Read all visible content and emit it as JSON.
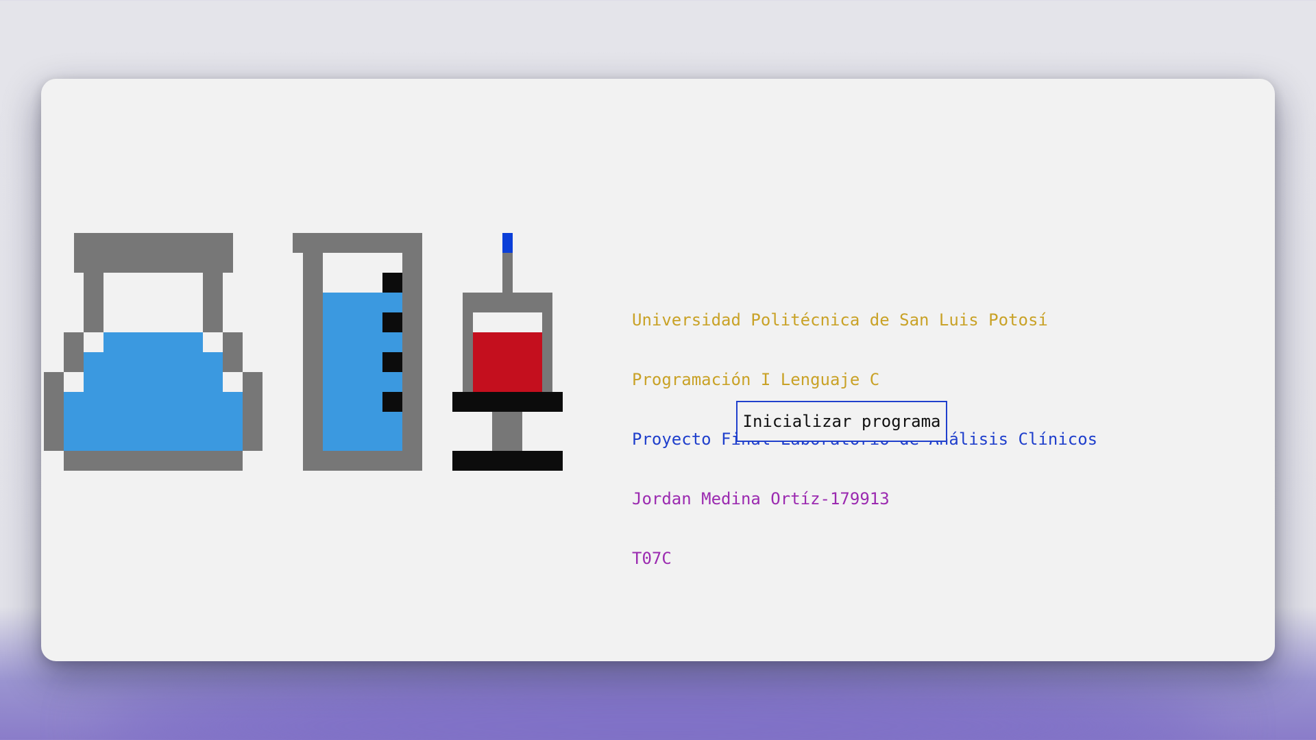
{
  "colors": {
    "university": "#c9a227",
    "course": "#c9a227",
    "project": "#1f3fcc",
    "author": "#9b2ab0",
    "group": "#9b2ab0",
    "gray": "#777777",
    "liquid_blue": "#3b99e0",
    "blood_red": "#c40f1e",
    "needle_blue": "#0b3fd8",
    "black": "#0c0c0c"
  },
  "icons": [
    "erlenmeyer-flask-icon",
    "graduated-cylinder-icon",
    "syringe-icon"
  ],
  "header": {
    "university": "Universidad Politécnica de San Luis Potosí",
    "course": "Programación I Lenguaje C",
    "project": "Proyecto Final Laboratorio de Análisis Clínicos",
    "author": "Jordan Medina Ortíz-179913",
    "group": "T07C"
  },
  "actions": {
    "start_label": "Inicializar programa"
  }
}
